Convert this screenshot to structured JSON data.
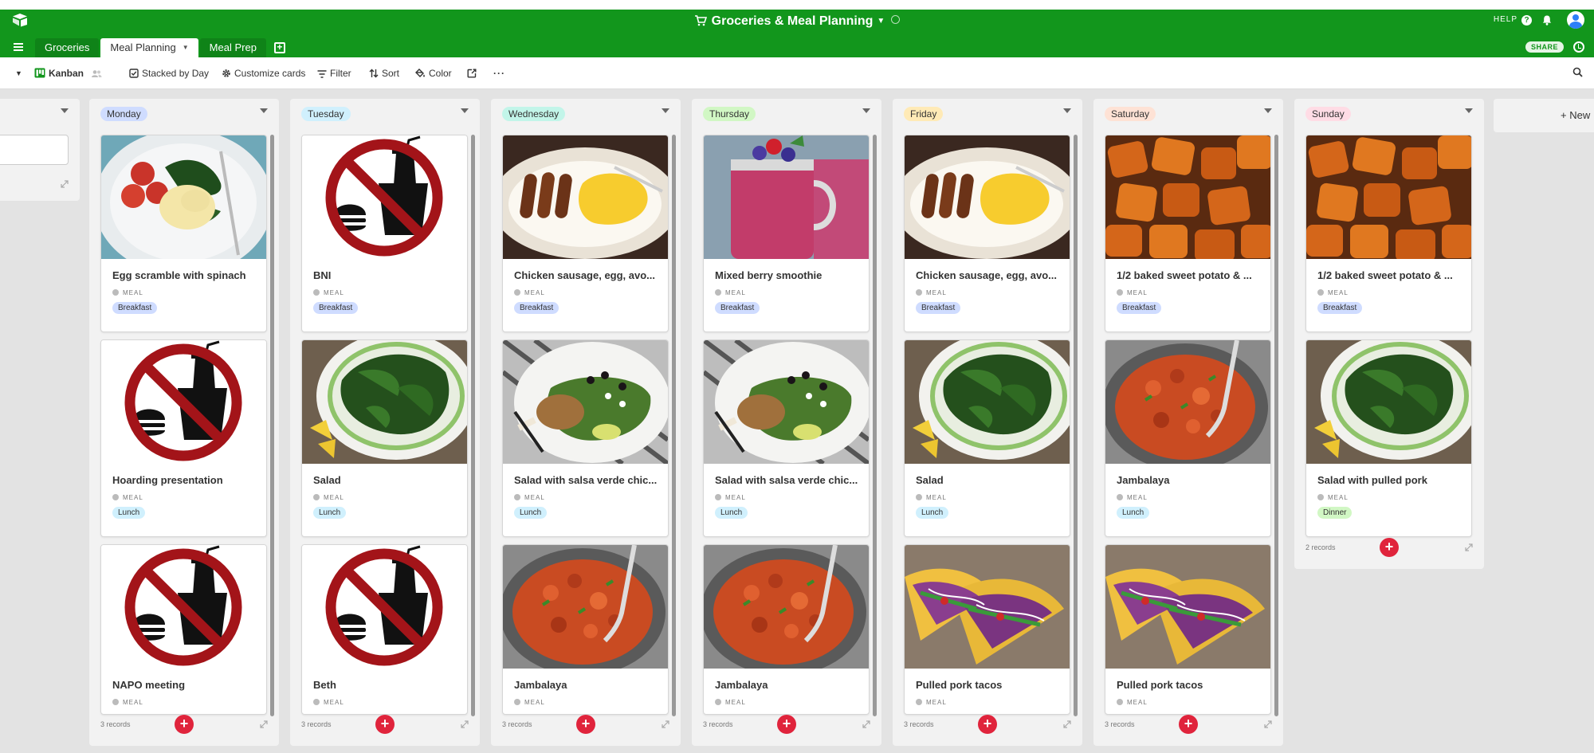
{
  "app": {
    "base_title": "Groceries & Meal Planning",
    "help_label": "HELP",
    "share_label": "SHARE",
    "icons": [
      "airtable-logo-icon",
      "cart-icon",
      "info-icon",
      "help-icon",
      "bell-icon",
      "avatar",
      "history-icon",
      "menu-icon",
      "add-table-icon"
    ]
  },
  "tabs": [
    {
      "label": "Groceries",
      "active": false
    },
    {
      "label": "Meal Planning",
      "active": true
    },
    {
      "label": "Meal Prep",
      "active": false
    }
  ],
  "toolbar": {
    "view_name": "Kanban",
    "stacked_by": "Stacked by Day",
    "customize": "Customize cards",
    "filter": "Filter",
    "sort": "Sort",
    "color": "Color"
  },
  "colors": {
    "header_green": "#12961c",
    "add_button_red": "#e0243c",
    "breakfast": "#cfdcff",
    "lunch": "#d0f0fd",
    "dinner": "#d1f7c4"
  },
  "field_label": "MEAL",
  "images": {
    "no-food": "no-food-sign",
    "egg-scramble": "egg-scramble-photo",
    "sausage-egg": "sausage-egg-photo",
    "smoothie": "berry-smoothie-photo",
    "sweet-potato": "sweet-potato-photo",
    "spinach-salad": "spinach-salad-photo",
    "chicken-salad": "chicken-salad-photo",
    "jambalaya": "jambalaya-photo",
    "tacos": "tacos-photo"
  },
  "stacks": [
    {
      "label": "Monday",
      "color": "#cfdcff",
      "footer": "3 records",
      "cards": [
        {
          "title": "Egg scramble with spinach",
          "meal": "Breakfast",
          "image": "egg-scramble"
        },
        {
          "title": "Hoarding presentation",
          "meal": "Lunch",
          "image": "no-food"
        },
        {
          "title": "NAPO meeting",
          "meal": "",
          "image": "no-food"
        }
      ]
    },
    {
      "label": "Tuesday",
      "color": "#d0f0fd",
      "footer": "3 records",
      "cards": [
        {
          "title": "BNI",
          "meal": "Breakfast",
          "image": "no-food"
        },
        {
          "title": "Salad",
          "meal": "Lunch",
          "image": "spinach-salad"
        },
        {
          "title": "Beth",
          "meal": "",
          "image": "no-food"
        }
      ]
    },
    {
      "label": "Wednesday",
      "color": "#c2f5e9",
      "footer": "3 records",
      "cards": [
        {
          "title": "Chicken sausage, egg, avo...",
          "meal": "Breakfast",
          "image": "sausage-egg"
        },
        {
          "title": "Salad with salsa verde chic...",
          "meal": "Lunch",
          "image": "chicken-salad"
        },
        {
          "title": "Jambalaya",
          "meal": "",
          "image": "jambalaya"
        }
      ]
    },
    {
      "label": "Thursday",
      "color": "#d1f7c4",
      "footer": "3 records",
      "cards": [
        {
          "title": "Mixed berry smoothie",
          "meal": "Breakfast",
          "image": "smoothie"
        },
        {
          "title": "Salad with salsa verde chic...",
          "meal": "Lunch",
          "image": "chicken-salad"
        },
        {
          "title": "Jambalaya",
          "meal": "",
          "image": "jambalaya"
        }
      ]
    },
    {
      "label": "Friday",
      "color": "#ffeab6",
      "footer": "3 records",
      "cards": [
        {
          "title": "Chicken sausage, egg, avo...",
          "meal": "Breakfast",
          "image": "sausage-egg"
        },
        {
          "title": "Salad",
          "meal": "Lunch",
          "image": "spinach-salad"
        },
        {
          "title": "Pulled pork tacos",
          "meal": "",
          "image": "tacos"
        }
      ]
    },
    {
      "label": "Saturday",
      "color": "#fee2d5",
      "footer": "3 records",
      "cards": [
        {
          "title": "1/2 baked sweet potato & ...",
          "meal": "Breakfast",
          "image": "sweet-potato"
        },
        {
          "title": "Jambalaya",
          "meal": "Lunch",
          "image": "jambalaya"
        },
        {
          "title": "Pulled pork tacos",
          "meal": "",
          "image": "tacos"
        }
      ]
    },
    {
      "label": "Sunday",
      "color": "#ffdce5",
      "footer": "2 records",
      "cards": [
        {
          "title": "1/2 baked sweet potato & ...",
          "meal": "Breakfast",
          "image": "sweet-potato"
        },
        {
          "title": "Salad with pulled pork",
          "meal": "Dinner",
          "image": "spinach-salad"
        }
      ]
    }
  ],
  "new_stack_label": "+ New"
}
